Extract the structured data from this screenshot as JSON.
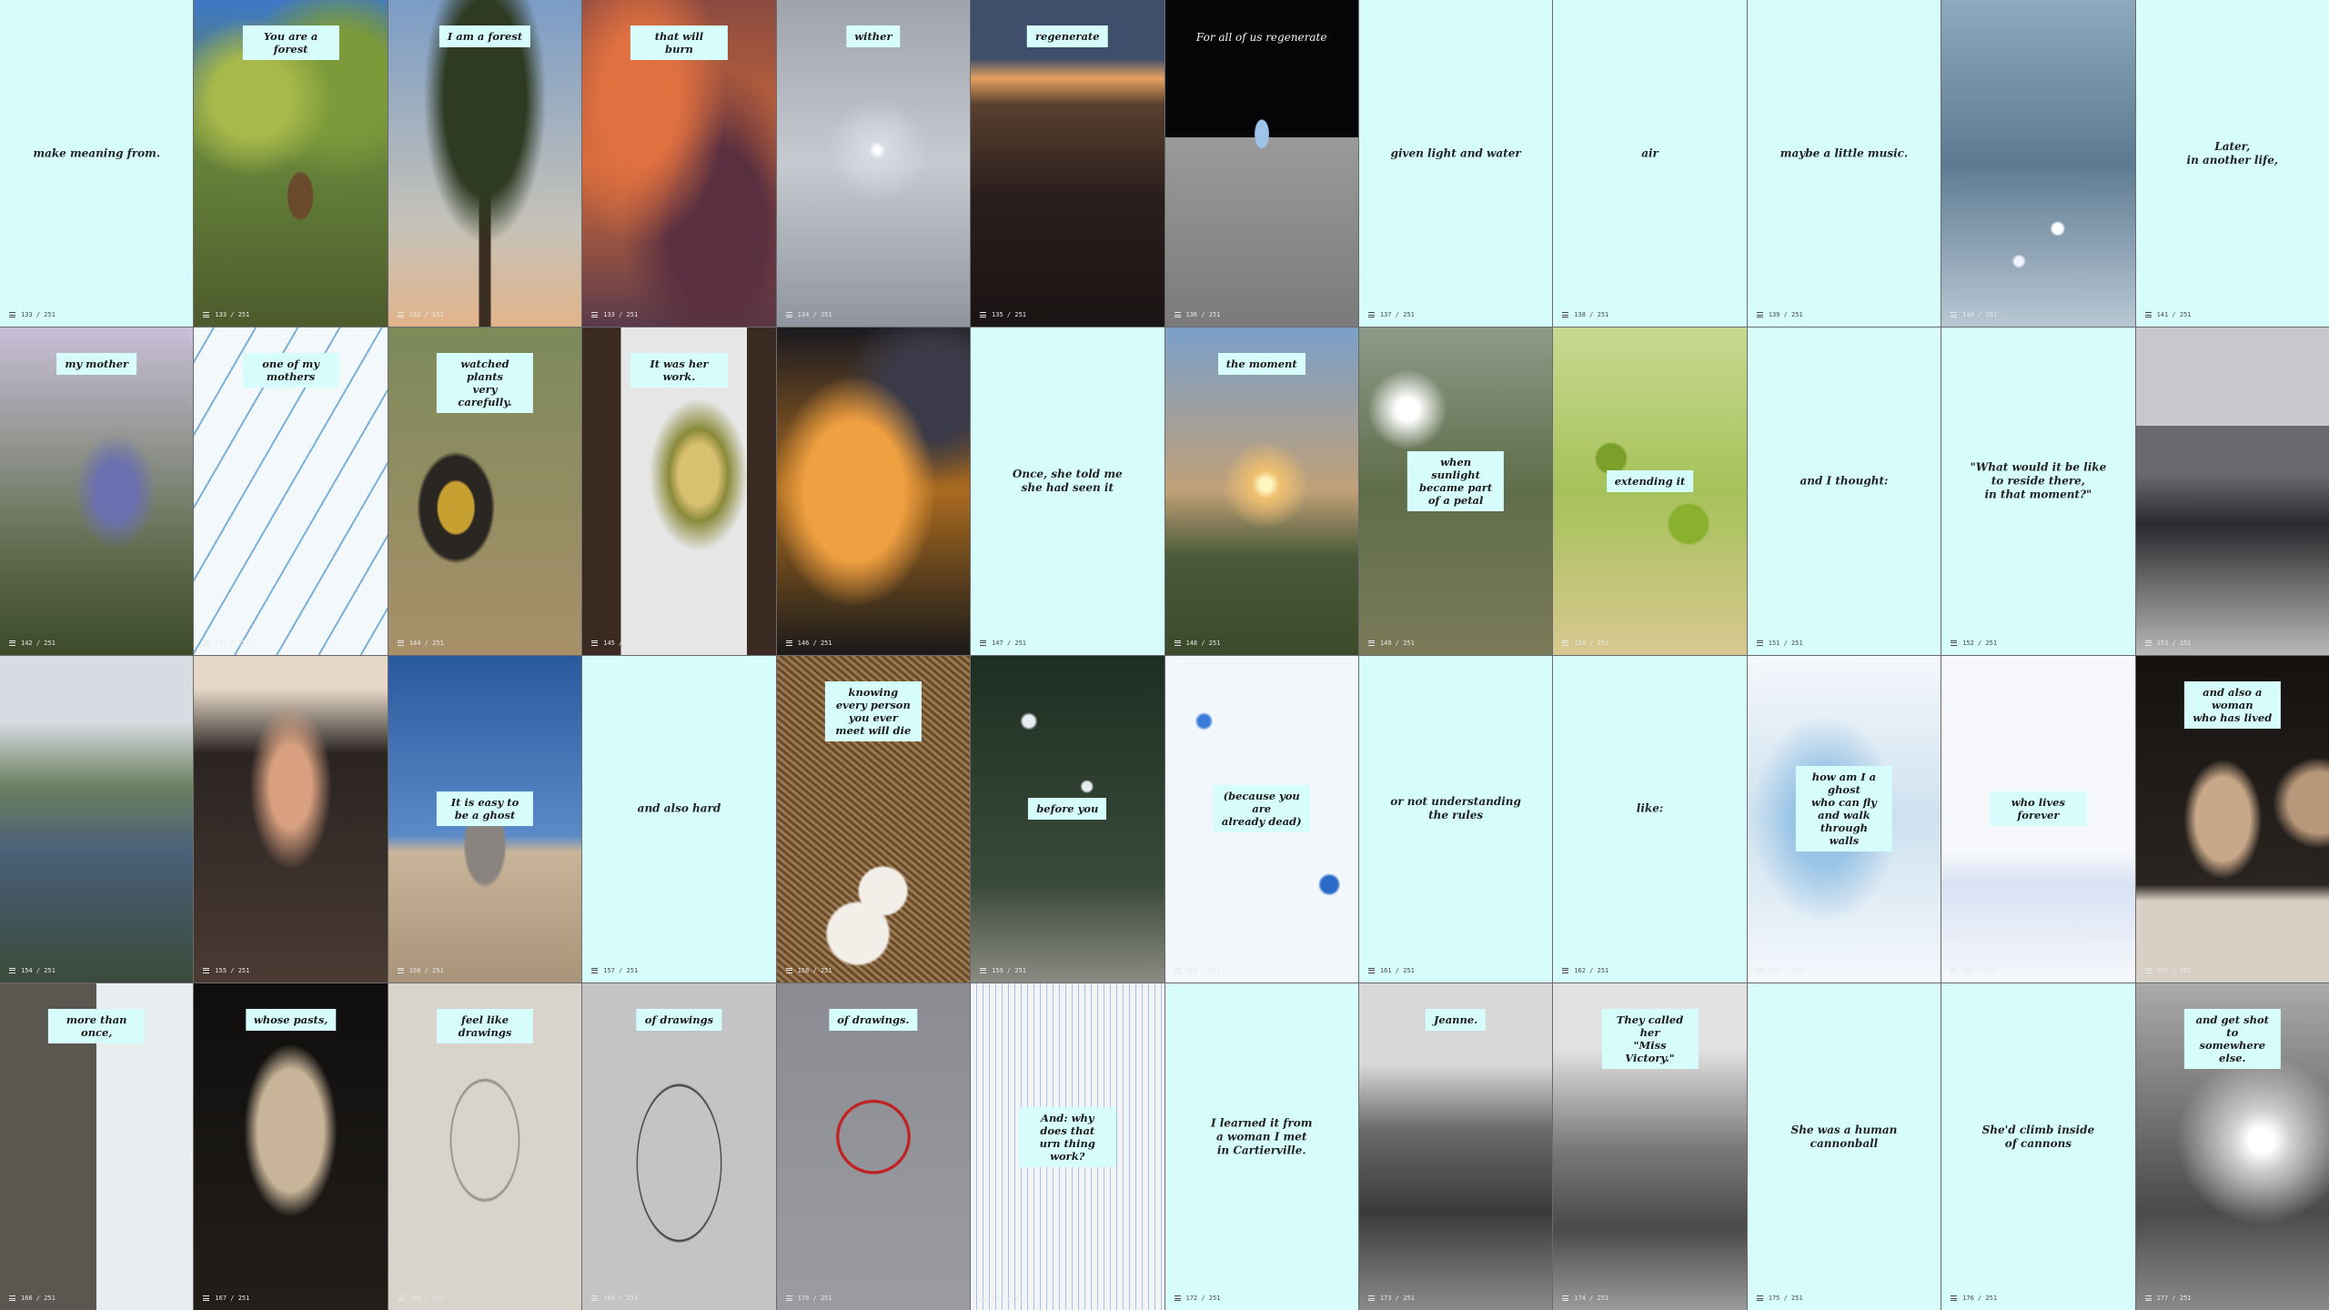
{
  "tiles": [
    {
      "kind": "text",
      "caption": "make meaning from.",
      "counter": "133 / 251"
    },
    {
      "kind": "photo",
      "scene": "tree-canopy",
      "bg": "#5d7a35",
      "caption": "You are a forest",
      "pos": "top",
      "counter": "133 / 251"
    },
    {
      "kind": "photo",
      "scene": "pine-tree",
      "bg": "#3f5570",
      "caption": "I am a forest",
      "pos": "top",
      "counter": "132 / 251"
    },
    {
      "kind": "photo",
      "scene": "red-clouds",
      "bg": "#b24e2e",
      "caption": "that will burn",
      "pos": "top",
      "counter": "133 / 251"
    },
    {
      "kind": "photo",
      "scene": "grey-sky",
      "bg": "#a9adb6",
      "caption": "wither",
      "pos": "top",
      "counter": "134 / 251"
    },
    {
      "kind": "photo",
      "scene": "sunset-crowd",
      "bg": "#3a2a28",
      "caption": "regenerate",
      "pos": "top",
      "counter": "135 / 251"
    },
    {
      "kind": "photo",
      "scene": "earthrise",
      "bg": "#0a0a0d",
      "caption": "For all of us regenerate",
      "pos": "plain",
      "counter": "136 / 251"
    },
    {
      "kind": "text",
      "caption": "given light and water",
      "counter": "137 / 251"
    },
    {
      "kind": "text",
      "caption": "air",
      "counter": "138 / 251"
    },
    {
      "kind": "text",
      "caption": "maybe a little music.",
      "counter": "139 / 251"
    },
    {
      "kind": "photo",
      "scene": "sparkling-water",
      "bg": "#6e8aa0",
      "caption": "",
      "pos": "none",
      "counter": "140 / 251"
    },
    {
      "kind": "text",
      "caption": "Later,\nin another life,",
      "counter": "141 / 251"
    },
    {
      "kind": "photo",
      "scene": "purple-flower",
      "bg": "#6b6d8a",
      "caption": "my mother",
      "pos": "top",
      "counter": "142 / 251"
    },
    {
      "kind": "photo",
      "scene": "blue-sketch",
      "bg": "#f3f8fb",
      "caption": "one of my mothers",
      "pos": "top",
      "counter": "143 / 251"
    },
    {
      "kind": "photo",
      "scene": "lichen-rock",
      "bg": "#8e7a55",
      "caption": "watched plants\nvery carefully.",
      "pos": "top",
      "counter": "144 / 251"
    },
    {
      "kind": "photo",
      "scene": "moss-table",
      "bg": "#3b2a22",
      "caption": "It was her work.",
      "pos": "top",
      "counter": "145 / 251"
    },
    {
      "kind": "photo",
      "scene": "orange-leaves",
      "bg": "#c88327",
      "caption": "",
      "pos": "none",
      "counter": "146 / 251"
    },
    {
      "kind": "text",
      "caption": "Once, she told me\nshe had seen it",
      "counter": "147 / 251"
    },
    {
      "kind": "photo",
      "scene": "sunrise-field",
      "bg": "#5d6d7d",
      "caption": "the moment",
      "pos": "top",
      "counter": "148 / 251"
    },
    {
      "kind": "photo",
      "scene": "underwater-plants",
      "bg": "#5f6d4a",
      "caption": "when sunlight\nbecame part of a petal",
      "pos": "mid",
      "counter": "149 / 251"
    },
    {
      "kind": "photo",
      "scene": "green-cells",
      "bg": "#a6c25a",
      "caption": "extending it",
      "pos": "mid",
      "counter": "150 / 251"
    },
    {
      "kind": "text",
      "caption": "and I thought:",
      "counter": "151 / 251"
    },
    {
      "kind": "text",
      "caption": "\"What would it be like\nto reside there,\nin that moment?\"",
      "counter": "152 / 251"
    },
    {
      "kind": "photo",
      "scene": "plaza-crowd",
      "bg": "#8e8e90",
      "caption": "",
      "pos": "none",
      "counter": "153 / 251"
    },
    {
      "kind": "photo",
      "scene": "river-statue",
      "bg": "#64785c",
      "caption": "",
      "pos": "none",
      "counter": "154 / 251"
    },
    {
      "kind": "photo",
      "scene": "raised-hands",
      "bg": "#4d3a30",
      "caption": "",
      "pos": "none",
      "counter": "155 / 251"
    },
    {
      "kind": "photo",
      "scene": "desert-hand",
      "bg": "#3a6fae",
      "caption": "It is easy to be a ghost",
      "pos": "mid",
      "counter": "156 / 251"
    },
    {
      "kind": "text",
      "caption": "and also hard",
      "counter": "157 / 251"
    },
    {
      "kind": "photo",
      "scene": "nest-eggs",
      "bg": "#7a5838",
      "caption": "knowing every person\nyou ever meet will die",
      "pos": "top",
      "counter": "158 / 251"
    },
    {
      "kind": "photo",
      "scene": "petals-water",
      "bg": "#29392a",
      "caption": "before you",
      "pos": "mid",
      "counter": "159 / 251"
    },
    {
      "kind": "photo",
      "scene": "blue-inverted",
      "bg": "#f1f7fb",
      "caption": "(because you are\nalready dead)",
      "pos": "mid",
      "counter": "160 / 251"
    },
    {
      "kind": "text",
      "caption": "or not understanding\nthe rules",
      "counter": "161 / 251"
    },
    {
      "kind": "text",
      "caption": "like:",
      "counter": "162 / 251"
    },
    {
      "kind": "photo",
      "scene": "pale-blue-sky",
      "bg": "#e4f0f8",
      "caption": "how am I a ghost\nwho can fly and walk\nthrough walls",
      "pos": "mid",
      "counter": "163 / 251"
    },
    {
      "kind": "photo",
      "scene": "white-haze",
      "bg": "#f3f6fb",
      "caption": "who lives forever",
      "pos": "mid",
      "counter": "164 / 251"
    },
    {
      "kind": "photo",
      "scene": "stone-heads",
      "bg": "#1c1816",
      "caption": "and also a woman\nwho has lived",
      "pos": "top",
      "counter": "165 / 251"
    },
    {
      "kind": "photo",
      "scene": "window-cat",
      "bg": "#4a4844",
      "caption": "more than once,",
      "pos": "top",
      "counter": "166 / 251"
    },
    {
      "kind": "photo",
      "scene": "stone-bust",
      "bg": "#171513",
      "caption": "whose pasts,",
      "pos": "top",
      "counter": "167 / 251"
    },
    {
      "kind": "photo",
      "scene": "pencil-face",
      "bg": "#d8d4cc",
      "caption": "feel like drawings",
      "pos": "top",
      "counter": "168 / 251"
    },
    {
      "kind": "photo",
      "scene": "line-face",
      "bg": "#c4c4c6",
      "caption": "of drawings",
      "pos": "top",
      "counter": "169 / 251"
    },
    {
      "kind": "photo",
      "scene": "red-circle",
      "bg": "#8e9096",
      "caption": "of drawings.",
      "pos": "top",
      "counter": "170 / 251"
    },
    {
      "kind": "photo",
      "scene": "inverted-portrait",
      "bg": "#f2f4f8",
      "caption": "And: why does that\nurn thing work?",
      "pos": "mid",
      "counter": "171 / 251"
    },
    {
      "kind": "text",
      "caption": "I learned it from\na woman I met\nin Cartierville.",
      "counter": "172 / 251"
    },
    {
      "kind": "photo",
      "scene": "bw-cannon",
      "bg": "#7c7c7c",
      "caption": "Jeanne.",
      "pos": "top",
      "counter": "173 / 251"
    },
    {
      "kind": "photo",
      "scene": "bw-cannon-2",
      "bg": "#858585",
      "caption": "They called her\n\"Miss Victory.\"",
      "pos": "top",
      "counter": "174 / 251"
    },
    {
      "kind": "text",
      "caption": "She was a human\ncannonball",
      "counter": "175 / 251"
    },
    {
      "kind": "text",
      "caption": "She'd climb inside\nof cannons",
      "counter": "176 / 251"
    },
    {
      "kind": "photo",
      "scene": "bw-sunburst",
      "bg": "#9a9a9a",
      "caption": "and get shot to\nsomewhere else.",
      "pos": "top",
      "counter": "177 / 251"
    }
  ]
}
